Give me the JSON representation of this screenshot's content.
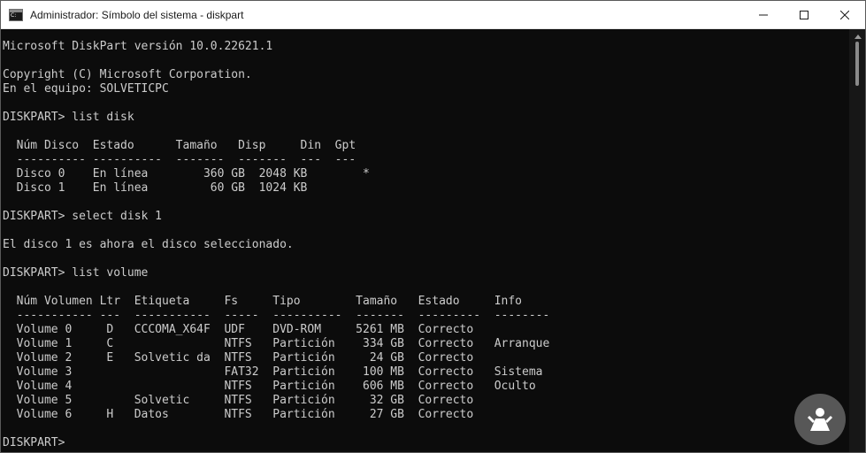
{
  "window": {
    "title": "Administrador: Símbolo del sistema - diskpart"
  },
  "controls": {
    "minimize": "minimize",
    "maximize": "maximize",
    "close": "close"
  },
  "console": {
    "lines": [
      "Microsoft DiskPart versión 10.0.22621.1",
      "",
      "Copyright (C) Microsoft Corporation.",
      "En el equipo: SOLVETICPC",
      "",
      "DISKPART> list disk",
      "",
      "  Núm Disco  Estado      Tamaño   Disp     Din  Gpt",
      "  ---------- ----------  -------  -------  ---  ---",
      "  Disco 0    En línea        360 GB  2048 KB        *",
      "  Disco 1    En línea         60 GB  1024 KB",
      "",
      "DISKPART> select disk 1",
      "",
      "El disco 1 es ahora el disco seleccionado.",
      "",
      "DISKPART> list volume",
      "",
      "  Núm Volumen Ltr  Etiqueta     Fs     Tipo        Tamaño   Estado     Info",
      "  ----------- ---  -----------  -----  ----------  -------  ---------  --------",
      "  Volume 0     D   CCCOMA_X64F  UDF    DVD-ROM     5261 MB  Correcto",
      "  Volume 1     C                NTFS   Partición    334 GB  Correcto   Arranque",
      "  Volume 2     E   Solvetic da  NTFS   Partición     24 GB  Correcto",
      "  Volume 3                      FAT32  Partición    100 MB  Correcto   Sistema",
      "  Volume 4                      NTFS   Partición    606 MB  Correcto   Oculto",
      "  Volume 5         Solvetic     NTFS   Partición     32 GB  Correcto",
      "  Volume 6     H   Datos        NTFS   Partición     27 GB  Correcto",
      "",
      "DISKPART> "
    ]
  },
  "colors": {
    "console_bg": "#0c0c0c",
    "console_fg": "#cccccc",
    "titlebar_bg": "#ffffff"
  },
  "icons": {
    "app": "cmd-icon",
    "watermark": "solvetic-logo"
  }
}
